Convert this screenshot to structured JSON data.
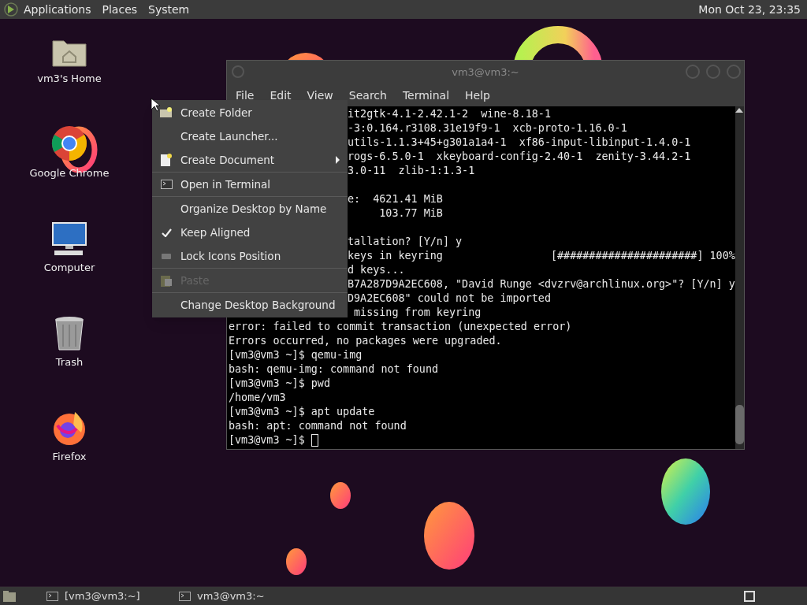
{
  "top_panel": {
    "menus": [
      "Applications",
      "Places",
      "System"
    ],
    "clock": "Mon Oct 23, 23:35"
  },
  "desktop_icons": [
    {
      "label": "vm3's Home",
      "kind": "home"
    },
    {
      "label": "Google Chrome",
      "kind": "browser"
    },
    {
      "label": "Computer",
      "kind": "computer"
    },
    {
      "label": "Trash",
      "kind": "trash"
    },
    {
      "label": "Firefox",
      "kind": "firefox"
    }
  ],
  "terminal": {
    "title": "vm3@vm3:~",
    "menus": [
      "File",
      "Edit",
      "View",
      "Search",
      "Terminal",
      "Help"
    ],
    "lines": [
      {
        "kind": "partial",
        "text": "it2gtk-4.1-2.42.1-2  wine-8.18-1"
      },
      {
        "kind": "partial",
        "text": "-3:0.164.r3108.31e19f9-1  xcb-proto-1.16.0-1"
      },
      {
        "kind": "partial",
        "text": "utils-1.1.3+45+g301a1a4-1  xf86-input-libinput-1.4.0-1"
      },
      {
        "kind": "partial",
        "text": "rogs-6.5.0-1  xkeyboard-config-2.40-1  zenity-3.44.2-1"
      },
      {
        "kind": "partial",
        "text": "3.0-11  zlib-1:1.3-1"
      },
      {
        "kind": "blank"
      },
      {
        "kind": "partial",
        "text": "e:  4621.41 MiB"
      },
      {
        "kind": "partial",
        "text": "     103.77 MiB"
      },
      {
        "kind": "blank"
      },
      {
        "kind": "partial",
        "text": "tallation? [Y/n] y"
      },
      {
        "kind": "partial",
        "text": "keys in keyring                 [######################] 100%"
      },
      {
        "kind": "partial",
        "text": "d keys..."
      },
      {
        "kind": "partial",
        "text": "B7A287D9A2EC608, \"David Runge <dvzrv@archlinux.org>\"? [Y/n] y"
      },
      {
        "kind": "partial",
        "text": "D9A2EC608\" could not be imported"
      },
      {
        "kind": "partial",
        "text": " missing from keyring"
      },
      {
        "kind": "full",
        "text": "error: failed to commit transaction (unexpected error)"
      },
      {
        "kind": "full",
        "text": "Errors occurred, no packages were upgraded."
      },
      {
        "kind": "full",
        "text": "[vm3@vm3 ~]$ qemu-img"
      },
      {
        "kind": "full",
        "text": "bash: qemu-img: command not found"
      },
      {
        "kind": "full",
        "text": "[vm3@vm3 ~]$ pwd"
      },
      {
        "kind": "full",
        "text": "/home/vm3"
      },
      {
        "kind": "full",
        "text": "[vm3@vm3 ~]$ apt update"
      },
      {
        "kind": "full",
        "text": "bash: apt: command not found"
      },
      {
        "kind": "prompt",
        "text": "[vm3@vm3 ~]$ "
      }
    ]
  },
  "context_menu": {
    "items": [
      {
        "label": "Create Folder",
        "kind": "folder",
        "checked": false,
        "disabled": false,
        "submenu": false,
        "separator_after": false
      },
      {
        "label": "Create Launcher...",
        "kind": "plain",
        "checked": false,
        "disabled": false,
        "submenu": false,
        "separator_after": false
      },
      {
        "label": "Create Document",
        "kind": "document",
        "checked": false,
        "disabled": false,
        "submenu": true,
        "separator_after": true
      },
      {
        "label": "Open in Terminal",
        "kind": "terminal",
        "checked": false,
        "disabled": false,
        "submenu": false,
        "separator_after": true
      },
      {
        "label": "Organize Desktop by Name",
        "kind": "plain",
        "checked": false,
        "disabled": false,
        "submenu": false,
        "separator_after": false
      },
      {
        "label": "Keep Aligned",
        "kind": "plain",
        "checked": true,
        "disabled": false,
        "submenu": false,
        "separator_after": false
      },
      {
        "label": "Lock Icons Position",
        "kind": "square",
        "checked": false,
        "disabled": false,
        "submenu": false,
        "separator_after": true
      },
      {
        "label": "Paste",
        "kind": "paste",
        "checked": false,
        "disabled": true,
        "submenu": false,
        "separator_after": true
      },
      {
        "label": "Change Desktop Background",
        "kind": "plain",
        "checked": false,
        "disabled": false,
        "submenu": false,
        "separator_after": false
      }
    ]
  },
  "taskbar": {
    "tasks": [
      {
        "label": "[vm3@vm3:~]"
      },
      {
        "label": "vm3@vm3:~"
      }
    ]
  }
}
